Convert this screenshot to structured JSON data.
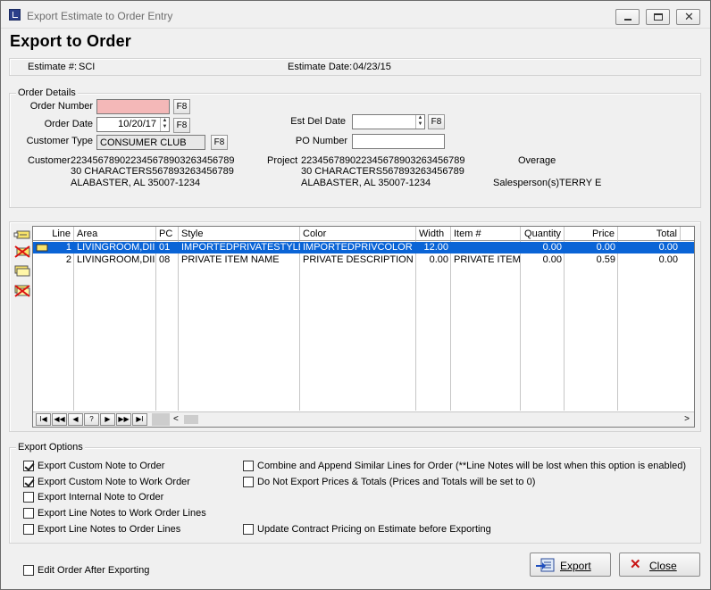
{
  "window": {
    "title": "Export Estimate to Order Entry"
  },
  "page": {
    "heading": "Export to Order"
  },
  "estimate": {
    "number_label": "Estimate #:",
    "number": "SCI",
    "date_label": "Estimate Date:",
    "date": "04/23/15"
  },
  "order_details": {
    "group_label": "Order Details",
    "order_number_label": "Order Number",
    "order_number": "",
    "order_date_label": "Order Date",
    "order_date": "10/20/17",
    "customer_type_label": "Customer Type",
    "customer_type": "CONSUMER CLUB",
    "est_del_date_label": "Est Del Date",
    "est_del_date": "",
    "po_number_label": "PO Number",
    "po_number": "",
    "f8": "F8",
    "customer_label": "Customer",
    "customer_lines": [
      "22345678902234567890326345678​9",
      "30 CHARACTERS567893263456789",
      "ALABASTER, AL 35007-1234"
    ],
    "project_label": "Project",
    "project_lines": [
      "223456789022345678903263456789",
      "30 CHARACTERS567893263456789",
      "ALABASTER, AL 35007-1234"
    ],
    "overage_label": "Overage",
    "salesperson_label": "Salesperson(s)",
    "salesperson": "TERRY E"
  },
  "grid": {
    "columns": [
      "Line",
      "Area",
      "PC",
      "Style",
      "Color",
      "Width",
      "Item #",
      "Quantity",
      "Price",
      "Total"
    ],
    "rows": [
      {
        "line": "1",
        "area": "LIVINGROOM,DII",
        "pc": "01",
        "style": "IMPORTEDPRIVATESTYLE",
        "color": "IMPORTEDPRIVCOLOR",
        "width": "12.00",
        "item": "",
        "quantity": "0.00",
        "price": "0.00",
        "total": "0.00"
      },
      {
        "line": "2",
        "area": "LIVINGROOM,DII",
        "pc": "08",
        "style": "PRIVATE ITEM NAME",
        "color": "PRIVATE DESCRIPTION",
        "width": "0.00",
        "item": "PRIVATE ITEM",
        "quantity": "0.00",
        "price": "0.59",
        "total": "0.00"
      }
    ],
    "nav": [
      "I◀",
      "◀◀",
      "◀",
      "?",
      "▶",
      "▶▶",
      "▶I"
    ]
  },
  "export_options": {
    "group_label": "Export Options",
    "options": [
      {
        "label": "Export Custom Note to Order",
        "checked": true
      },
      {
        "label": "Export Custom Note to Work Order",
        "checked": true
      },
      {
        "label": "Export Internal Note to Order",
        "checked": false
      },
      {
        "label": "Export Line Notes to Work Order Lines",
        "checked": false
      },
      {
        "label": "Export Line Notes to Order Lines",
        "checked": false
      },
      {
        "label": "Combine and Append Similar Lines for Order (**Line Notes will be lost when this option is enabled)",
        "checked": false
      },
      {
        "label": "Do Not Export Prices & Totals (Prices and Totals will be set to 0)",
        "checked": false
      },
      {
        "label": "Update Contract Pricing on Estimate before Exporting",
        "checked": false
      }
    ]
  },
  "footer": {
    "edit_after_label": "Edit Order After Exporting",
    "export_label": "Export",
    "close_label": "Close"
  },
  "colors": {
    "selection": "#0a64d6",
    "order_number_required": "#f4b8b8"
  }
}
